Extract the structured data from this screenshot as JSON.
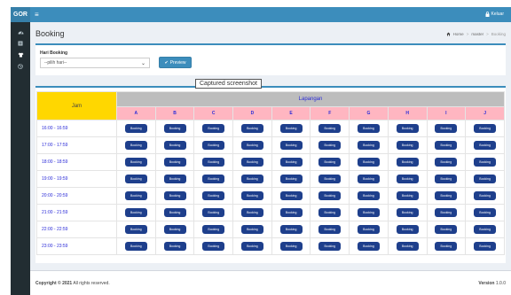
{
  "brand": "GOR",
  "header": {
    "logout_label": "Keluar"
  },
  "sidebar": {
    "icons": [
      "dashboard-icon",
      "list-icon",
      "shirt-icon",
      "dribbble-icon"
    ]
  },
  "page": {
    "title": "Booking",
    "breadcrumb": [
      "Home",
      "master",
      "Booking"
    ]
  },
  "form": {
    "label": "Hari Booking",
    "select_value": "--pilih hari--",
    "preview_label": "Preview"
  },
  "tooltip": "Captured screenshot",
  "table": {
    "jam_header": "Jam",
    "lapangan_header": "Lapangan",
    "courts": [
      "A",
      "B",
      "C",
      "D",
      "E",
      "F",
      "G",
      "H",
      "I",
      "J"
    ],
    "times": [
      "16:00 - 16:59",
      "17:00 - 17:59",
      "18:00 - 18:59",
      "19:00 - 19:59",
      "20:00 - 20:59",
      "21:00 - 21:59",
      "22:00 - 22:59",
      "23:00 - 23:59"
    ],
    "button_label": "Booking"
  },
  "footer": {
    "copyright_bold": "Copyright © 2021",
    "copyright_rest": " All rights reserved.",
    "version_label": "Version",
    "version_value": " 1.0.0"
  },
  "colors": {
    "header": "#3c8dbc",
    "sidebar": "#222d32",
    "jam_header": "#ffd700",
    "lapangan_header": "#bdbdbd",
    "court_header": "#ffb6c1",
    "booking_button": "#1e3f8c",
    "time_text": "#2b2bd8"
  }
}
